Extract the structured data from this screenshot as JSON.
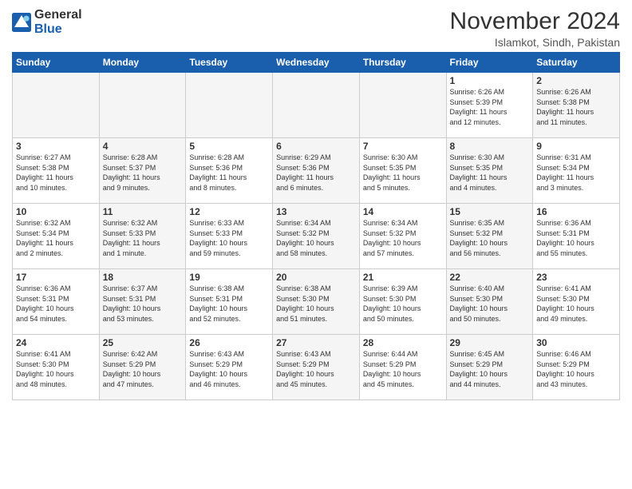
{
  "logo": {
    "general": "General",
    "blue": "Blue"
  },
  "header": {
    "month": "November 2024",
    "location": "Islamkot, Sindh, Pakistan"
  },
  "weekdays": [
    "Sunday",
    "Monday",
    "Tuesday",
    "Wednesday",
    "Thursday",
    "Friday",
    "Saturday"
  ],
  "weeks": [
    [
      {
        "day": "",
        "info": "",
        "empty": true
      },
      {
        "day": "",
        "info": "",
        "empty": true
      },
      {
        "day": "",
        "info": "",
        "empty": true
      },
      {
        "day": "",
        "info": "",
        "empty": true
      },
      {
        "day": "",
        "info": "",
        "empty": true
      },
      {
        "day": "1",
        "info": "Sunrise: 6:26 AM\nSunset: 5:39 PM\nDaylight: 11 hours\nand 12 minutes.",
        "shade": false
      },
      {
        "day": "2",
        "info": "Sunrise: 6:26 AM\nSunset: 5:38 PM\nDaylight: 11 hours\nand 11 minutes.",
        "shade": true
      }
    ],
    [
      {
        "day": "3",
        "info": "Sunrise: 6:27 AM\nSunset: 5:38 PM\nDaylight: 11 hours\nand 10 minutes.",
        "shade": false
      },
      {
        "day": "4",
        "info": "Sunrise: 6:28 AM\nSunset: 5:37 PM\nDaylight: 11 hours\nand 9 minutes.",
        "shade": true
      },
      {
        "day": "5",
        "info": "Sunrise: 6:28 AM\nSunset: 5:36 PM\nDaylight: 11 hours\nand 8 minutes.",
        "shade": false
      },
      {
        "day": "6",
        "info": "Sunrise: 6:29 AM\nSunset: 5:36 PM\nDaylight: 11 hours\nand 6 minutes.",
        "shade": true
      },
      {
        "day": "7",
        "info": "Sunrise: 6:30 AM\nSunset: 5:35 PM\nDaylight: 11 hours\nand 5 minutes.",
        "shade": false
      },
      {
        "day": "8",
        "info": "Sunrise: 6:30 AM\nSunset: 5:35 PM\nDaylight: 11 hours\nand 4 minutes.",
        "shade": true
      },
      {
        "day": "9",
        "info": "Sunrise: 6:31 AM\nSunset: 5:34 PM\nDaylight: 11 hours\nand 3 minutes.",
        "shade": false
      }
    ],
    [
      {
        "day": "10",
        "info": "Sunrise: 6:32 AM\nSunset: 5:34 PM\nDaylight: 11 hours\nand 2 minutes.",
        "shade": false
      },
      {
        "day": "11",
        "info": "Sunrise: 6:32 AM\nSunset: 5:33 PM\nDaylight: 11 hours\nand 1 minute.",
        "shade": true
      },
      {
        "day": "12",
        "info": "Sunrise: 6:33 AM\nSunset: 5:33 PM\nDaylight: 10 hours\nand 59 minutes.",
        "shade": false
      },
      {
        "day": "13",
        "info": "Sunrise: 6:34 AM\nSunset: 5:32 PM\nDaylight: 10 hours\nand 58 minutes.",
        "shade": true
      },
      {
        "day": "14",
        "info": "Sunrise: 6:34 AM\nSunset: 5:32 PM\nDaylight: 10 hours\nand 57 minutes.",
        "shade": false
      },
      {
        "day": "15",
        "info": "Sunrise: 6:35 AM\nSunset: 5:32 PM\nDaylight: 10 hours\nand 56 minutes.",
        "shade": true
      },
      {
        "day": "16",
        "info": "Sunrise: 6:36 AM\nSunset: 5:31 PM\nDaylight: 10 hours\nand 55 minutes.",
        "shade": false
      }
    ],
    [
      {
        "day": "17",
        "info": "Sunrise: 6:36 AM\nSunset: 5:31 PM\nDaylight: 10 hours\nand 54 minutes.",
        "shade": false
      },
      {
        "day": "18",
        "info": "Sunrise: 6:37 AM\nSunset: 5:31 PM\nDaylight: 10 hours\nand 53 minutes.",
        "shade": true
      },
      {
        "day": "19",
        "info": "Sunrise: 6:38 AM\nSunset: 5:31 PM\nDaylight: 10 hours\nand 52 minutes.",
        "shade": false
      },
      {
        "day": "20",
        "info": "Sunrise: 6:38 AM\nSunset: 5:30 PM\nDaylight: 10 hours\nand 51 minutes.",
        "shade": true
      },
      {
        "day": "21",
        "info": "Sunrise: 6:39 AM\nSunset: 5:30 PM\nDaylight: 10 hours\nand 50 minutes.",
        "shade": false
      },
      {
        "day": "22",
        "info": "Sunrise: 6:40 AM\nSunset: 5:30 PM\nDaylight: 10 hours\nand 50 minutes.",
        "shade": true
      },
      {
        "day": "23",
        "info": "Sunrise: 6:41 AM\nSunset: 5:30 PM\nDaylight: 10 hours\nand 49 minutes.",
        "shade": false
      }
    ],
    [
      {
        "day": "24",
        "info": "Sunrise: 6:41 AM\nSunset: 5:30 PM\nDaylight: 10 hours\nand 48 minutes.",
        "shade": false
      },
      {
        "day": "25",
        "info": "Sunrise: 6:42 AM\nSunset: 5:29 PM\nDaylight: 10 hours\nand 47 minutes.",
        "shade": true
      },
      {
        "day": "26",
        "info": "Sunrise: 6:43 AM\nSunset: 5:29 PM\nDaylight: 10 hours\nand 46 minutes.",
        "shade": false
      },
      {
        "day": "27",
        "info": "Sunrise: 6:43 AM\nSunset: 5:29 PM\nDaylight: 10 hours\nand 45 minutes.",
        "shade": true
      },
      {
        "day": "28",
        "info": "Sunrise: 6:44 AM\nSunset: 5:29 PM\nDaylight: 10 hours\nand 45 minutes.",
        "shade": false
      },
      {
        "day": "29",
        "info": "Sunrise: 6:45 AM\nSunset: 5:29 PM\nDaylight: 10 hours\nand 44 minutes.",
        "shade": true
      },
      {
        "day": "30",
        "info": "Sunrise: 6:46 AM\nSunset: 5:29 PM\nDaylight: 10 hours\nand 43 minutes.",
        "shade": false
      }
    ]
  ]
}
